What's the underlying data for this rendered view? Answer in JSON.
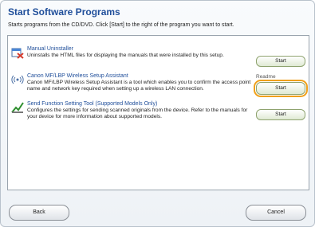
{
  "window": {
    "title": "Start Software Programs",
    "instruction": "Starts programs from the CD/DVD. Click [Start] to the right of the program you want to start."
  },
  "programs": [
    {
      "name": "Manual Uninstaller",
      "description": "Uninstalls the HTML files for displaying the manuals that were installed by this setup.",
      "start_label": "Start",
      "icon": "uninstaller-icon"
    },
    {
      "name": "Canon MF/LBP Wireless Setup Assistant",
      "description": "Canon MF/LBP Wireless Setup Assistant is a tool which enables you to confirm the access point name and network key required when setting up a wireless LAN connection.",
      "start_label": "Start",
      "readme_label": "Readme",
      "icon": "wireless-icon"
    },
    {
      "name": "Send Function Setting Tool (Supported Models Only)",
      "description": "Configures the settings for sending scanned originals from the device. Refer to the manuals for your device for more information about supported models.",
      "start_label": "Start",
      "icon": "send-settings-icon"
    }
  ],
  "footer": {
    "back_label": "Back",
    "cancel_label": "Cancel"
  },
  "colors": {
    "title": "#1f4e9a",
    "focus": "#f0a01a"
  }
}
